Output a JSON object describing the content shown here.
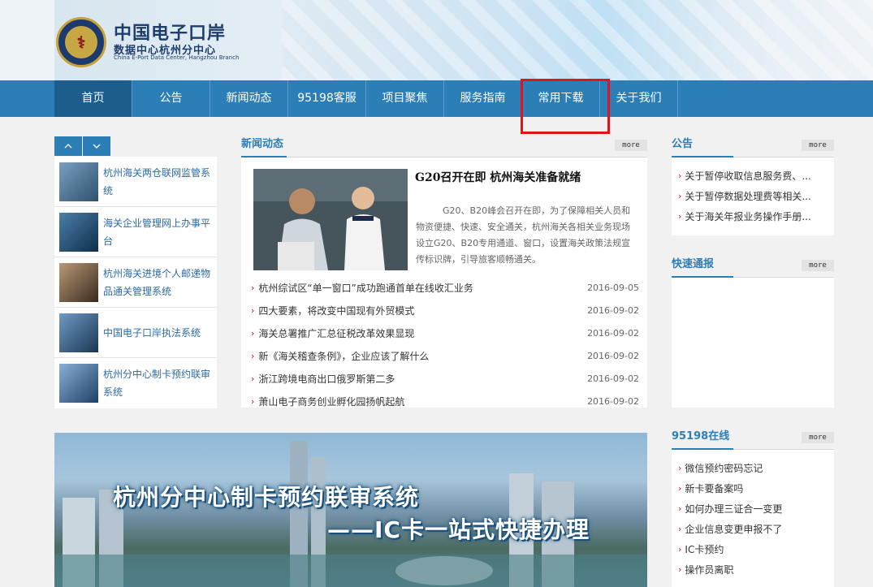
{
  "header": {
    "logo_title": "中国电子口岸",
    "logo_subtitle": "数据中心杭州分中心",
    "logo_english": "China E-Port Data Center, Hangzhou Branch"
  },
  "nav": {
    "items": [
      {
        "label": "首页",
        "active": true
      },
      {
        "label": "公告"
      },
      {
        "label": "新闻动态"
      },
      {
        "label": "95198客服"
      },
      {
        "label": "项目聚焦"
      },
      {
        "label": "服务指南"
      },
      {
        "label": "常用下载"
      },
      {
        "label": "关于我们"
      }
    ]
  },
  "left_list": {
    "up_icon": "chevron-up-icon",
    "down_icon": "chevron-down-icon",
    "items": [
      {
        "label": "杭州海关两仓联网监管系统"
      },
      {
        "label": "海关企业管理网上办事平台"
      },
      {
        "label": "杭州海关进境个人邮递物品通关管理系统"
      },
      {
        "label": "中国电子口岸执法系统"
      },
      {
        "label": "杭州分中心制卡预约联审系统"
      }
    ]
  },
  "news": {
    "title": "新闻动态",
    "more": "more",
    "feature": {
      "title": "G20召开在即 杭州海关准备就绪",
      "desc": "G20、B20峰会召开在即，为了保障相关人员和物资便捷、快速、安全通关，杭州海关各相关业务现场设立G20、B20专用通道、窗口，设置海关政策法规宣传标识牌，引导旅客顺畅通关。"
    },
    "items": [
      {
        "title": "杭州综试区“单一窗口”成功跑通首单在线收汇业务",
        "date": "2016-09-05"
      },
      {
        "title": "四大要素，将改变中国现有外贸模式",
        "date": "2016-09-02"
      },
      {
        "title": "海关总署推广汇总征税改革效果显现",
        "date": "2016-09-02"
      },
      {
        "title": "新《海关稽查条例》，企业应该了解什么",
        "date": "2016-09-02"
      },
      {
        "title": "浙江跨境电商出口俄罗斯第二多",
        "date": "2016-09-02"
      },
      {
        "title": "萧山电子商务创业孵化园扬帆起航",
        "date": "2016-09-02"
      }
    ]
  },
  "banner": {
    "line1": "杭州分中心制卡预约联审系统",
    "line2": "——IC卡一站式快捷办理"
  },
  "notice": {
    "title": "公告",
    "more": "more",
    "items": [
      {
        "title": "关于暂停收取信息服务费、..."
      },
      {
        "title": "关于暂停数据处理费等相关..."
      },
      {
        "title": "关于海关年报业务操作手册..."
      }
    ]
  },
  "quick": {
    "title": "快速通报",
    "more": "more"
  },
  "online": {
    "title": "95198在线",
    "more": "more",
    "items": [
      {
        "title": "微信预约密码忘记"
      },
      {
        "title": "新卡要备案吗"
      },
      {
        "title": "如何办理三证合一变更"
      },
      {
        "title": "企业信息变更申报不了"
      },
      {
        "title": "IC卡预约"
      },
      {
        "title": "操作员离职"
      }
    ]
  },
  "colors": {
    "nav": "#2c7eb7",
    "nav_active": "#1d5d8d",
    "accent_red": "#c0141c",
    "highlight": "#e0141c"
  }
}
